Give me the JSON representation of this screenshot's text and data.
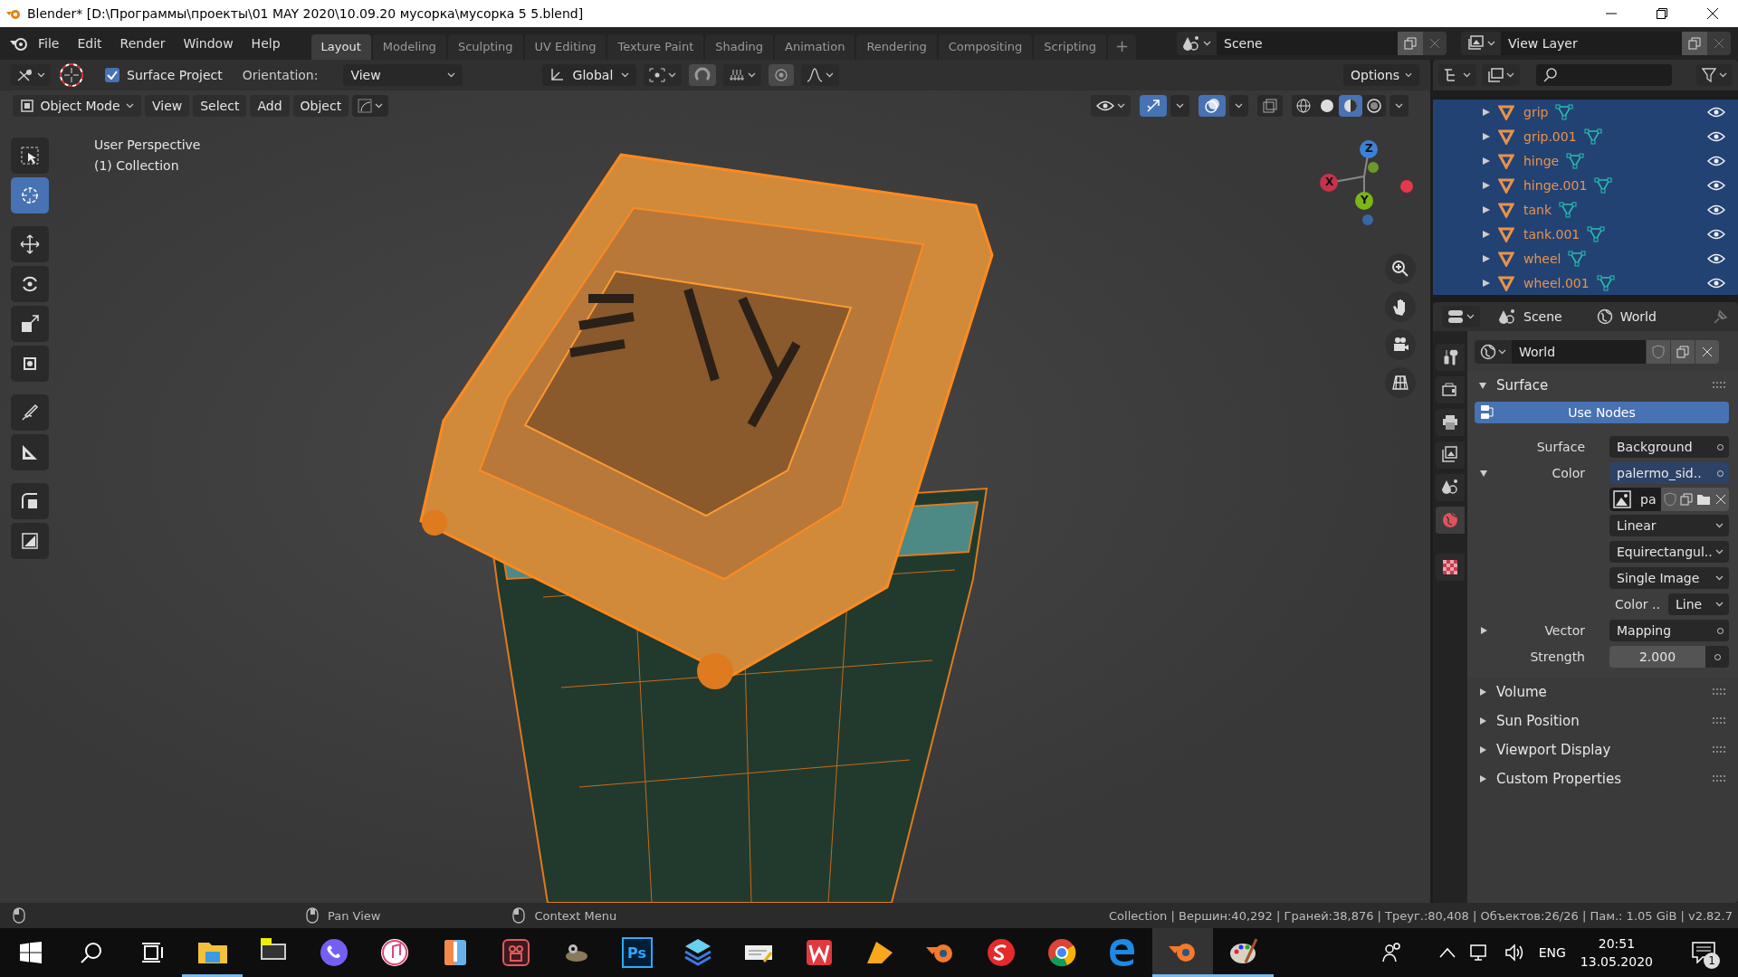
{
  "window": {
    "title": "Blender* [D:\\Программы\\проекты\\01 MAY 2020\\10.09.20 мусорка\\мусорка 5 5.blend]"
  },
  "menu": [
    "File",
    "Edit",
    "Render",
    "Window",
    "Help"
  ],
  "workspaces": [
    {
      "label": "Layout",
      "selected": true
    },
    {
      "label": "Modeling",
      "selected": false
    },
    {
      "label": "Sculpting",
      "selected": false
    },
    {
      "label": "UV Editing",
      "selected": false
    },
    {
      "label": "Texture Paint",
      "selected": false
    },
    {
      "label": "Shading",
      "selected": false
    },
    {
      "label": "Animation",
      "selected": false
    },
    {
      "label": "Rendering",
      "selected": false
    },
    {
      "label": "Compositing",
      "selected": false
    },
    {
      "label": "Scripting",
      "selected": false
    }
  ],
  "add_workspace": "+",
  "scene": "Scene",
  "view_layer": "View Layer",
  "tool_header": {
    "surface_project": {
      "label": "Surface Project",
      "checked": true
    },
    "orientation_label": "Orientation:",
    "orientation": "View",
    "transform_orientation": "Global",
    "options": "Options"
  },
  "viewport_header": {
    "mode": "Object Mode",
    "menus": [
      "View",
      "Select",
      "Add",
      "Object"
    ],
    "gizmos_on": true,
    "overlays_on": true,
    "xray_on": false,
    "shading": [
      {
        "kind": "wireframe",
        "selected": false
      },
      {
        "kind": "solid",
        "selected": false
      },
      {
        "kind": "material",
        "selected": true
      },
      {
        "kind": "rendered",
        "selected": false
      }
    ]
  },
  "viewport": {
    "overlay_lines": [
      "User Perspective",
      "(1) Collection"
    ],
    "axes": [
      "X",
      "Y",
      "Z"
    ]
  },
  "tools": [
    {
      "kind": "select",
      "selected": false
    },
    {
      "kind": "cursor",
      "selected": true
    },
    {
      "kind": "move",
      "selected": false
    },
    {
      "kind": "rotate",
      "selected": false
    },
    {
      "kind": "scale",
      "selected": false
    },
    {
      "kind": "transform",
      "selected": false
    },
    {
      "kind": "annotate",
      "selected": false
    },
    {
      "kind": "measure",
      "selected": false
    },
    {
      "kind": "add-cube",
      "selected": false
    },
    {
      "kind": "bevel",
      "selected": false
    }
  ],
  "outliner": {
    "items": [
      {
        "name": "grip",
        "selected": true,
        "visible": true
      },
      {
        "name": "grip.001",
        "selected": true,
        "visible": true
      },
      {
        "name": "hinge",
        "selected": true,
        "visible": true
      },
      {
        "name": "hinge.001",
        "selected": true,
        "visible": true
      },
      {
        "name": "tank",
        "selected": true,
        "visible": true
      },
      {
        "name": "tank.001",
        "selected": true,
        "visible": true
      },
      {
        "name": "wheel",
        "selected": true,
        "visible": true
      },
      {
        "name": "wheel.001",
        "selected": true,
        "visible": true
      }
    ]
  },
  "properties": {
    "breadcrumbs": [
      "Scene",
      "World"
    ],
    "tabs": [
      {
        "kind": "tool",
        "selected": false
      },
      {
        "kind": "render",
        "selected": false
      },
      {
        "kind": "output",
        "selected": false
      },
      {
        "kind": "view-layer",
        "selected": false
      },
      {
        "kind": "scene",
        "selected": false
      },
      {
        "kind": "world",
        "selected": true
      },
      {
        "kind": "texture",
        "selected": false
      }
    ],
    "world_name": "World",
    "surface_panel": {
      "title": "Surface",
      "expanded": true,
      "use_nodes": "Use Nodes",
      "rows": [
        {
          "kind": "socket",
          "label": "Surface",
          "value": "Background"
        },
        {
          "kind": "input",
          "label": "Color",
          "value": "palermo_sid..",
          "expanded": true
        },
        {
          "kind": "image",
          "value": "pa"
        },
        {
          "kind": "dropdown",
          "value": "Linear"
        },
        {
          "kind": "dropdown",
          "value": "Equirectangul.."
        },
        {
          "kind": "dropdown",
          "value": "Single Image"
        },
        {
          "kind": "pair",
          "label": "Color ..",
          "value": "Line"
        },
        {
          "kind": "input",
          "label": "Vector",
          "value": "Mapping",
          "expanded": false
        },
        {
          "kind": "number",
          "label": "Strength",
          "value": "2.000"
        }
      ]
    },
    "panels": [
      {
        "title": "Volume",
        "expanded": false
      },
      {
        "title": "Sun Position",
        "expanded": false
      },
      {
        "title": "Viewport Display",
        "expanded": false
      },
      {
        "title": "Custom Properties",
        "expanded": false
      }
    ]
  },
  "status_bar": {
    "hints": [
      "Pan View",
      "Context Menu"
    ],
    "stats": "Collection | Вершин:40,292 | Граней:38,876 | Треуг.:80,408 | Объектов:26/26 | Пам.: 1.05 GiB | v2.82.7"
  },
  "taskbar": {
    "apps": [
      {
        "kind": "explorer",
        "running": true,
        "selected": false
      },
      {
        "kind": "monitor",
        "running": false,
        "selected": false
      },
      {
        "kind": "viber",
        "running": false,
        "selected": false
      },
      {
        "kind": "music",
        "running": false,
        "selected": false
      },
      {
        "kind": "thermometer",
        "running": false,
        "selected": false
      },
      {
        "kind": "video",
        "running": false,
        "selected": false
      },
      {
        "kind": "gimp",
        "running": false,
        "selected": false
      },
      {
        "kind": "photoshop",
        "label": "Ps",
        "running": false,
        "selected": false
      },
      {
        "kind": "layers",
        "running": false,
        "selected": false
      },
      {
        "kind": "notepad",
        "running": false,
        "selected": false
      },
      {
        "kind": "office",
        "running": false,
        "selected": false
      },
      {
        "kind": "folder",
        "running": false,
        "selected": false
      },
      {
        "kind": "blender",
        "running": false,
        "selected": false
      },
      {
        "kind": "substance",
        "running": false,
        "selected": false
      },
      {
        "kind": "chrome",
        "running": false,
        "selected": false
      },
      {
        "kind": "edge",
        "running": false,
        "selected": false
      },
      {
        "kind": "blender",
        "running": true,
        "selected": true
      },
      {
        "kind": "paint",
        "running": true,
        "selected": false
      }
    ],
    "language": "ENG",
    "time": "20:51",
    "date": "13.05.2020",
    "notifications": "1"
  }
}
